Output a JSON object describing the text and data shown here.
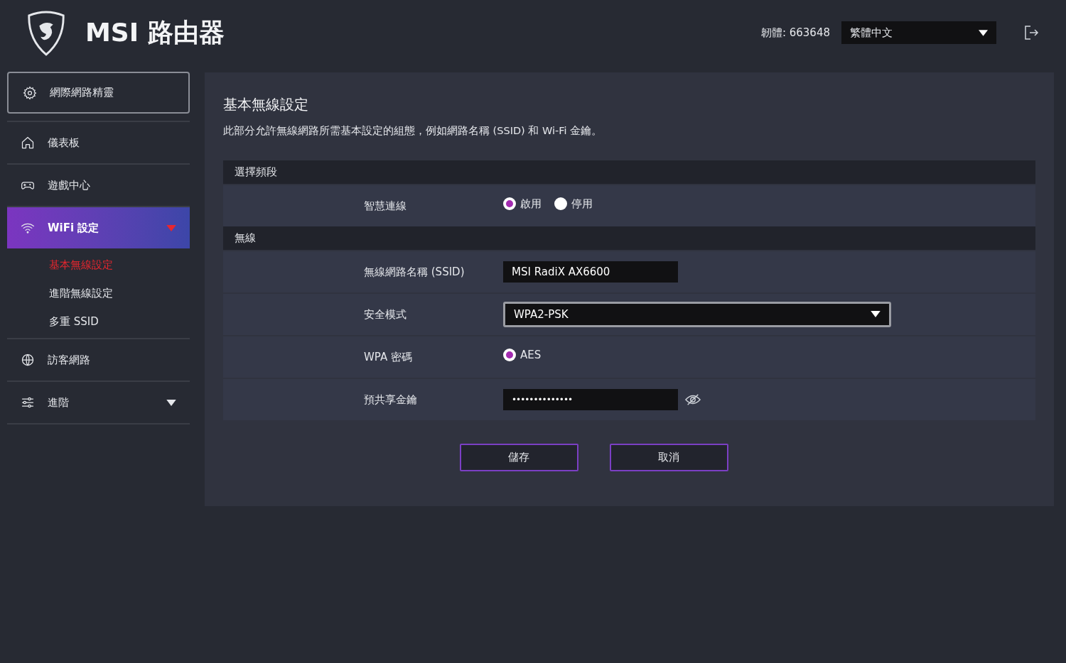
{
  "header": {
    "brand": "MSI 路由器",
    "firmware": "韌體: 663648",
    "language": "繁體中文"
  },
  "sidebar": {
    "wizard": "網際網路精靈",
    "items": [
      {
        "label": "儀表板",
        "selected": false
      },
      {
        "label": "遊戲中心",
        "selected": false
      },
      {
        "label": "WiFi 設定",
        "selected": true,
        "expanded": true,
        "children": [
          {
            "label": "基本無線設定",
            "selected": true
          },
          {
            "label": "進階無線設定",
            "selected": false
          },
          {
            "label": "多重 SSID",
            "selected": false
          }
        ]
      },
      {
        "label": "訪客網路",
        "selected": false
      },
      {
        "label": "進階",
        "selected": false,
        "expanded": false
      }
    ]
  },
  "page": {
    "title": "基本無線設定",
    "description": "此部分允許無線網路所需基本設定的組態，例如網路名稱 (SSID) 和 Wi-Fi 金鑰。",
    "sections": [
      {
        "title": "選擇頻段",
        "rows": [
          {
            "kind": "radio",
            "label": "智慧連線",
            "options": [
              {
                "label": "啟用",
                "selected": true
              },
              {
                "label": "停用",
                "selected": false
              }
            ]
          }
        ]
      },
      {
        "title": "無線",
        "rows": [
          {
            "kind": "text",
            "label": "無線網路名稱 (SSID)",
            "value": "MSI RadiX AX6600"
          },
          {
            "kind": "select",
            "label": "安全模式",
            "value": "WPA2-PSK"
          },
          {
            "kind": "radio",
            "label": "WPA 密碼",
            "options": [
              {
                "label": "AES",
                "selected": true
              }
            ]
          },
          {
            "kind": "password",
            "label": "預共享金鑰",
            "value": "••••••••••••••"
          }
        ]
      }
    ],
    "buttons": [
      "儲存",
      "取消"
    ]
  }
}
